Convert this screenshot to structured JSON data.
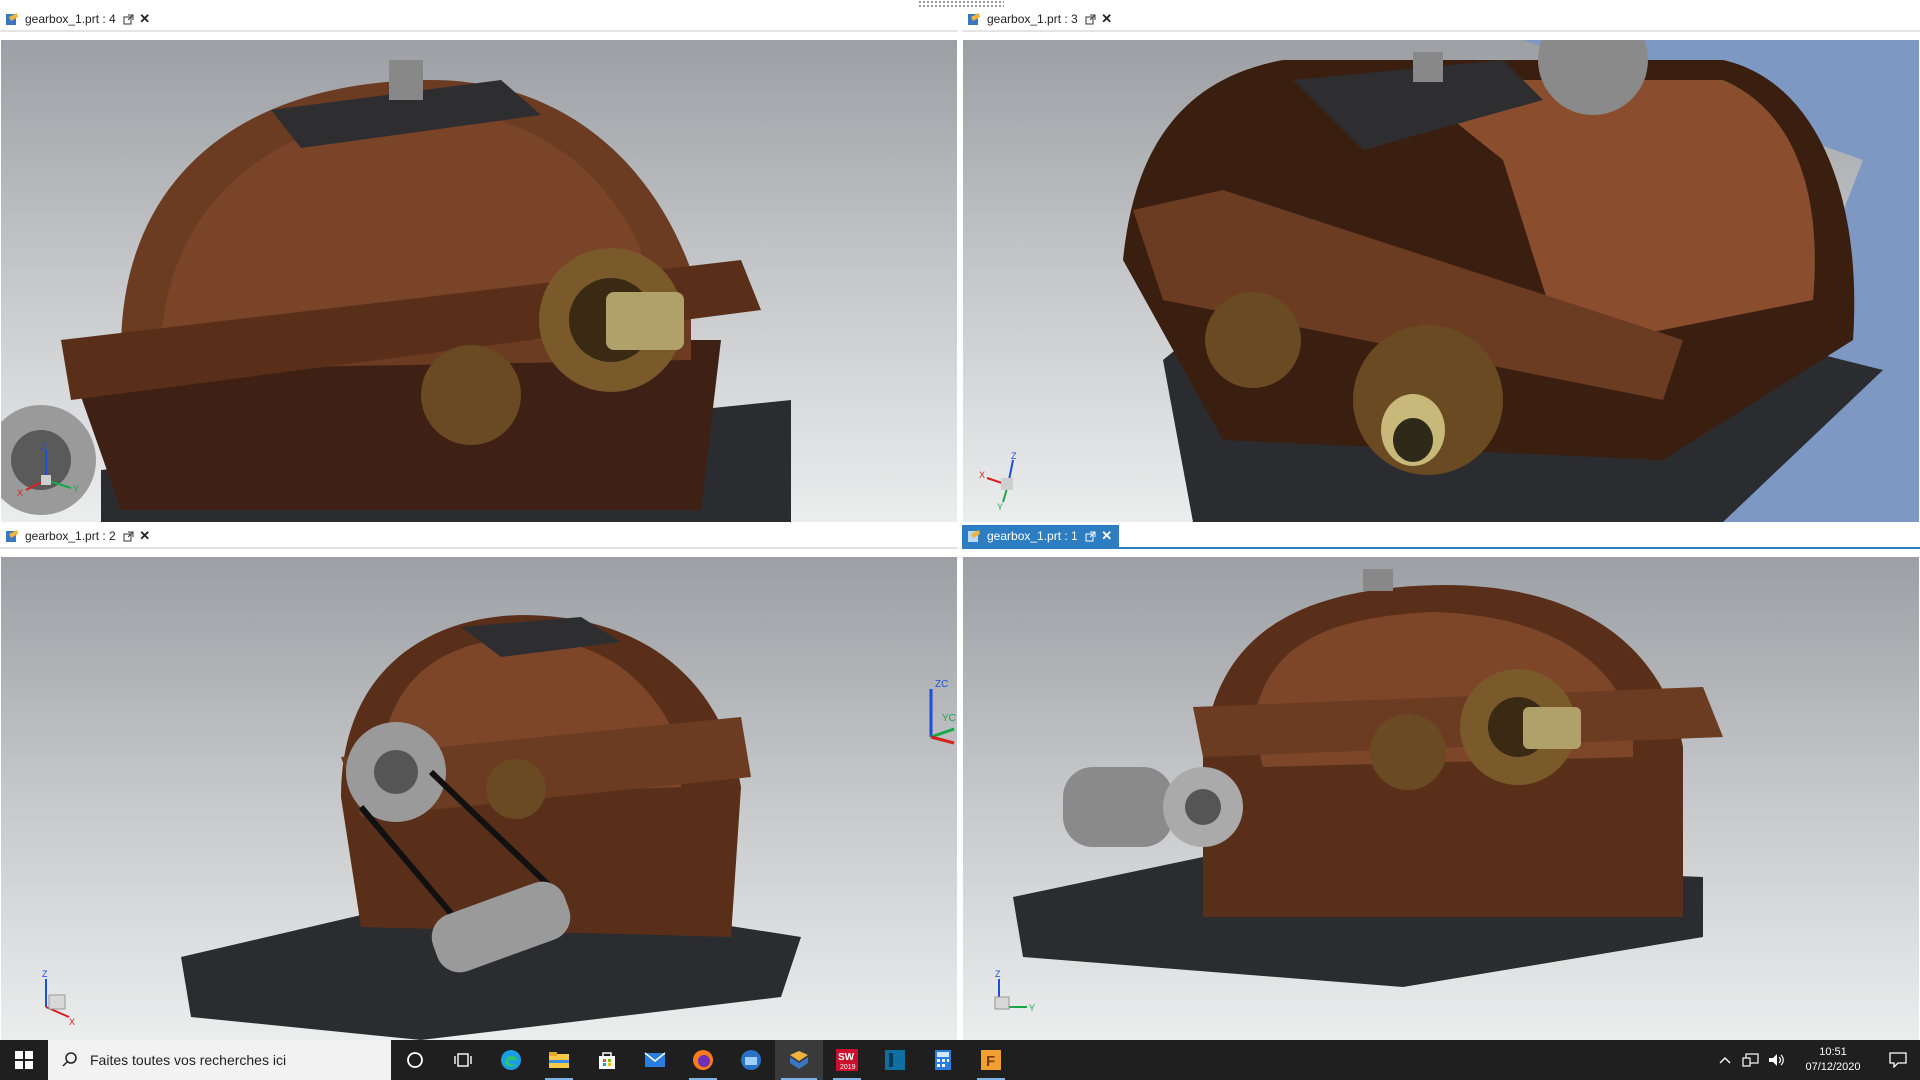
{
  "viewports": [
    {
      "id": "vp4",
      "title": "gearbox_1.prt : 4",
      "active": false,
      "triad": [
        "Z",
        "Y",
        "X"
      ]
    },
    {
      "id": "vp3",
      "title": "gearbox_1.prt : 3",
      "active": false,
      "triad": [
        "Z",
        "Y",
        "X"
      ]
    },
    {
      "id": "vp2",
      "title": "gearbox_1.prt : 2",
      "active": false,
      "triad": [
        "Z",
        "X",
        "ZC",
        "YC"
      ]
    },
    {
      "id": "vp1",
      "title": "gearbox_1.prt : 1",
      "active": true,
      "triad": [
        "Z",
        "Y"
      ]
    }
  ],
  "taskbar": {
    "search_placeholder": "Faites toutes vos recherches ici",
    "apps": [
      {
        "name": "cortana-icon"
      },
      {
        "name": "task-view-icon"
      },
      {
        "name": "edge-icon"
      },
      {
        "name": "file-explorer-icon"
      },
      {
        "name": "store-icon"
      },
      {
        "name": "mail-icon"
      },
      {
        "name": "firefox-icon"
      },
      {
        "name": "outlook-icon"
      },
      {
        "name": "nx-icon"
      },
      {
        "name": "solidworks-icon",
        "badge": "2019"
      },
      {
        "name": "app-dark-icon"
      },
      {
        "name": "calculator-icon"
      },
      {
        "name": "app-f-icon",
        "label": "F"
      }
    ],
    "time": "10:51",
    "date": "07/12/2020"
  },
  "colors": {
    "active_tab": "#2d7dc2",
    "casing_brown": "#6b3b22",
    "base_dark": "#2a2c30",
    "taskbar": "#1f1f1f"
  }
}
